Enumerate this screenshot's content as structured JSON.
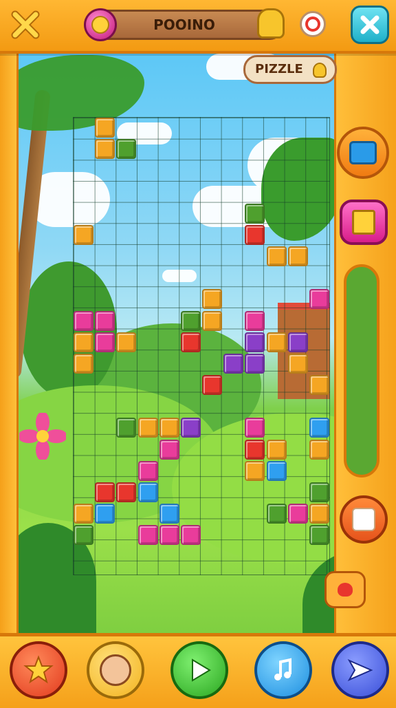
{
  "header": {
    "title": "POOINO",
    "puzzle_label": "PIZZLE"
  },
  "colors": {
    "orange": "#f5a623",
    "red": "#e8362d",
    "pink": "#e93c9b",
    "purple": "#8a3fc8",
    "blue": "#2f9ff0",
    "green": "#4fa02e",
    "frame": "#f39a12",
    "frame_border": "#d7780a"
  },
  "board": {
    "columns": 12,
    "rows": 22,
    "blocks": [
      {
        "col": 1,
        "row": 0,
        "color": "orange"
      },
      {
        "col": 1,
        "row": 1,
        "color": "orange"
      },
      {
        "col": 2,
        "row": 1,
        "color": "green"
      },
      {
        "col": 8,
        "row": 4,
        "color": "green"
      },
      {
        "col": 0,
        "row": 5,
        "color": "orange"
      },
      {
        "col": 8,
        "row": 5,
        "color": "red"
      },
      {
        "col": 9,
        "row": 6,
        "color": "orange"
      },
      {
        "col": 10,
        "row": 6,
        "color": "orange"
      },
      {
        "col": 6,
        "row": 8,
        "color": "orange"
      },
      {
        "col": 11,
        "row": 8,
        "color": "pink"
      },
      {
        "col": 0,
        "row": 9,
        "color": "pink"
      },
      {
        "col": 1,
        "row": 9,
        "color": "pink"
      },
      {
        "col": 5,
        "row": 9,
        "color": "green"
      },
      {
        "col": 6,
        "row": 9,
        "color": "orange"
      },
      {
        "col": 8,
        "row": 9,
        "color": "pink"
      },
      {
        "col": 0,
        "row": 10,
        "color": "orange"
      },
      {
        "col": 1,
        "row": 10,
        "color": "pink"
      },
      {
        "col": 2,
        "row": 10,
        "color": "orange"
      },
      {
        "col": 5,
        "row": 10,
        "color": "red"
      },
      {
        "col": 8,
        "row": 10,
        "color": "purple"
      },
      {
        "col": 9,
        "row": 10,
        "color": "orange"
      },
      {
        "col": 10,
        "row": 10,
        "color": "purple"
      },
      {
        "col": 0,
        "row": 11,
        "color": "orange"
      },
      {
        "col": 7,
        "row": 11,
        "color": "purple"
      },
      {
        "col": 8,
        "row": 11,
        "color": "purple"
      },
      {
        "col": 10,
        "row": 11,
        "color": "orange"
      },
      {
        "col": 6,
        "row": 12,
        "color": "red"
      },
      {
        "col": 11,
        "row": 12,
        "color": "orange"
      },
      {
        "col": 2,
        "row": 14,
        "color": "green"
      },
      {
        "col": 3,
        "row": 14,
        "color": "orange"
      },
      {
        "col": 4,
        "row": 14,
        "color": "orange"
      },
      {
        "col": 5,
        "row": 14,
        "color": "purple"
      },
      {
        "col": 8,
        "row": 14,
        "color": "pink"
      },
      {
        "col": 11,
        "row": 14,
        "color": "blue"
      },
      {
        "col": 4,
        "row": 15,
        "color": "pink"
      },
      {
        "col": 8,
        "row": 15,
        "color": "red"
      },
      {
        "col": 9,
        "row": 15,
        "color": "orange"
      },
      {
        "col": 11,
        "row": 15,
        "color": "orange"
      },
      {
        "col": 3,
        "row": 16,
        "color": "pink"
      },
      {
        "col": 8,
        "row": 16,
        "color": "orange"
      },
      {
        "col": 9,
        "row": 16,
        "color": "blue"
      },
      {
        "col": 1,
        "row": 17,
        "color": "red"
      },
      {
        "col": 2,
        "row": 17,
        "color": "red"
      },
      {
        "col": 3,
        "row": 17,
        "color": "blue"
      },
      {
        "col": 11,
        "row": 17,
        "color": "green"
      },
      {
        "col": 0,
        "row": 18,
        "color": "orange"
      },
      {
        "col": 1,
        "row": 18,
        "color": "blue"
      },
      {
        "col": 4,
        "row": 18,
        "color": "blue"
      },
      {
        "col": 9,
        "row": 18,
        "color": "green"
      },
      {
        "col": 10,
        "row": 18,
        "color": "pink"
      },
      {
        "col": 11,
        "row": 18,
        "color": "orange"
      },
      {
        "col": 0,
        "row": 19,
        "color": "green"
      },
      {
        "col": 3,
        "row": 19,
        "color": "pink"
      },
      {
        "col": 4,
        "row": 19,
        "color": "pink"
      },
      {
        "col": 5,
        "row": 19,
        "color": "pink"
      },
      {
        "col": 11,
        "row": 19,
        "color": "green"
      }
    ]
  },
  "icons": {
    "close_left": "cross-icon",
    "coin": "coin-icon",
    "trophy": "trophy-icon",
    "target": "target-icon",
    "close_right": "close-icon",
    "camera": "camera-icon",
    "card": "card-icon",
    "dice": "dice-icon",
    "heart_basket": "heart-icon"
  },
  "bottom_buttons": [
    {
      "name": "star-button",
      "icon": "star-icon",
      "color": "#f0552e"
    },
    {
      "name": "character-button",
      "icon": "character-icon",
      "color": "#f8c23a"
    },
    {
      "name": "play-button",
      "icon": "play-icon",
      "color": "#3fc033"
    },
    {
      "name": "music-button",
      "icon": "music-icon",
      "color": "#2ea8ec"
    },
    {
      "name": "send-button",
      "icon": "send-icon",
      "color": "#4459e0"
    }
  ]
}
